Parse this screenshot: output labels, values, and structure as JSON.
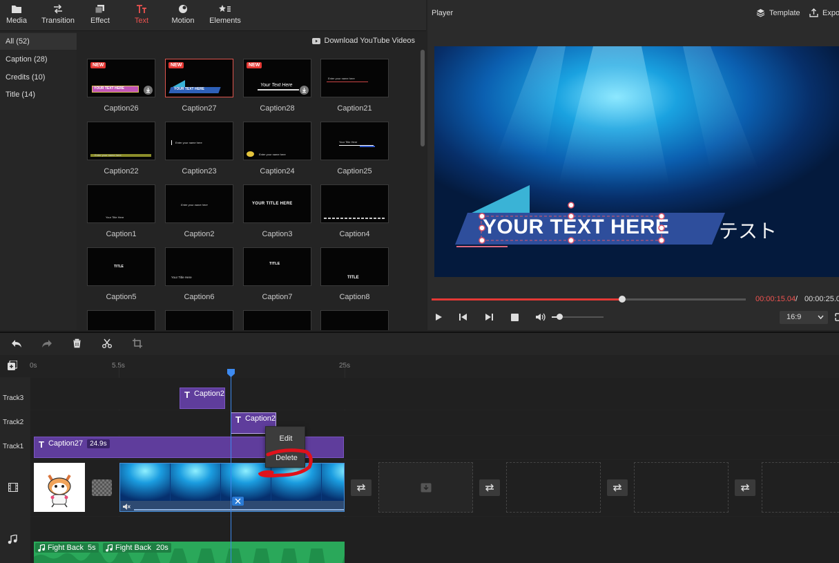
{
  "toolbar": {
    "items": [
      {
        "label": "Media",
        "icon": "folder-icon"
      },
      {
        "label": "Transition",
        "icon": "transition-icon"
      },
      {
        "label": "Effect",
        "icon": "effect-icon"
      },
      {
        "label": "Text",
        "icon": "text-icon",
        "active": true
      },
      {
        "label": "Motion",
        "icon": "motion-icon"
      },
      {
        "label": "Elements",
        "icon": "elements-icon"
      }
    ],
    "active_color": "#ef5350"
  },
  "sidebar": {
    "items": [
      {
        "label": "All (52)",
        "active": true
      },
      {
        "label": "Caption (28)"
      },
      {
        "label": "Credits (10)"
      },
      {
        "label": "Title (14)"
      }
    ]
  },
  "library": {
    "download_link": "Download YouTube Videos",
    "new_badge": "NEW",
    "items": [
      {
        "label": "Caption26",
        "new": true,
        "download": true,
        "text": "YOUR TEXT HERE"
      },
      {
        "label": "Caption27",
        "new": true,
        "selected": true,
        "text": "YOUR TEXT HERE"
      },
      {
        "label": "Caption28",
        "new": true,
        "download": true,
        "text": "Your Text Here"
      },
      {
        "label": "Caption21",
        "text": "Enter your name here"
      },
      {
        "label": "Caption22",
        "text": "Enter your name here"
      },
      {
        "label": "Caption23",
        "text": "Enter your name here"
      },
      {
        "label": "Caption24",
        "text": "Enter your name here"
      },
      {
        "label": "Caption25",
        "text": "Your Title Here"
      },
      {
        "label": "Caption1",
        "text": "Your Title Here"
      },
      {
        "label": "Caption2",
        "text": "Enter your name here"
      },
      {
        "label": "Caption3",
        "text": "YOUR TITLE HERE"
      },
      {
        "label": "Caption4",
        "text": ""
      },
      {
        "label": "Caption5",
        "text": "TITLE"
      },
      {
        "label": "Caption6",
        "text": "Your Title Here"
      },
      {
        "label": "Caption7",
        "text": "TITLE"
      },
      {
        "label": "Caption8",
        "text": "TITLE"
      }
    ]
  },
  "player": {
    "title": "Player",
    "template_label": "Template",
    "export_label": "Expo",
    "overlay_text": "YOUR TEXT HERE",
    "extra_text": "テスト",
    "time_current": "00:00:15.04",
    "time_sep": "/",
    "time_total": "00:00:25.0",
    "progress": 0.607,
    "volume": 0.15,
    "aspect": "16:9"
  },
  "timeline": {
    "ticks": [
      "0s",
      "5.5s",
      "25s"
    ],
    "tracks": [
      "Track3",
      "Track2",
      "Track1"
    ],
    "clips": {
      "track3": {
        "label": "Caption2"
      },
      "track2": {
        "label": "Caption2"
      },
      "track1": {
        "label": "Caption27",
        "duration": "24.9s"
      }
    },
    "context_menu": {
      "edit": "Edit",
      "delete": "Delete"
    },
    "audio": [
      {
        "label": "Fight Back",
        "duration": "5s"
      },
      {
        "label": "Fight Back",
        "duration": "20s"
      }
    ]
  }
}
